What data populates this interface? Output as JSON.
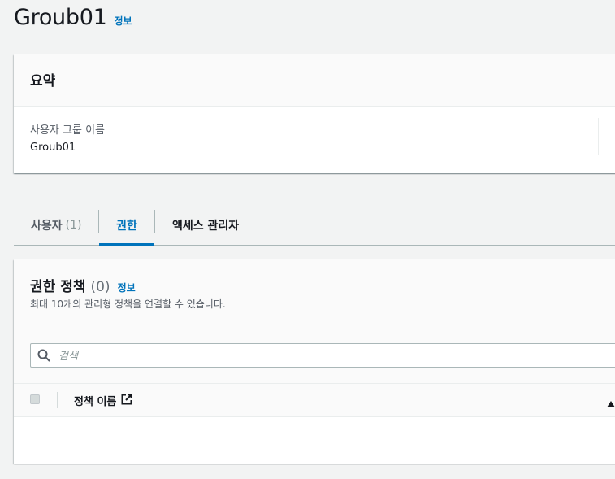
{
  "page": {
    "title": "Groub01",
    "info_link": "정보"
  },
  "summary": {
    "title": "요약",
    "group_name_label": "사용자 그룹 이름",
    "group_name_value": "Groub01"
  },
  "tabs": [
    {
      "label": "사용자",
      "count": "(1)",
      "active": false
    },
    {
      "label": "권한",
      "active": true
    },
    {
      "label": "액세스 관리자",
      "active": false
    }
  ],
  "permissions": {
    "title": "권한 정책",
    "count": "(0)",
    "info_link": "정보",
    "description": "최대 10개의 관리형 정책을 연결할 수 있습니다.",
    "search_placeholder": "검색",
    "table": {
      "columns": [
        "정책 이름"
      ],
      "rows": []
    }
  },
  "colors": {
    "link": "#0073bb",
    "active_tab": "#0073bb",
    "text": "#16191f",
    "secondary_text": "#545b64",
    "background": "#f2f3f3"
  }
}
